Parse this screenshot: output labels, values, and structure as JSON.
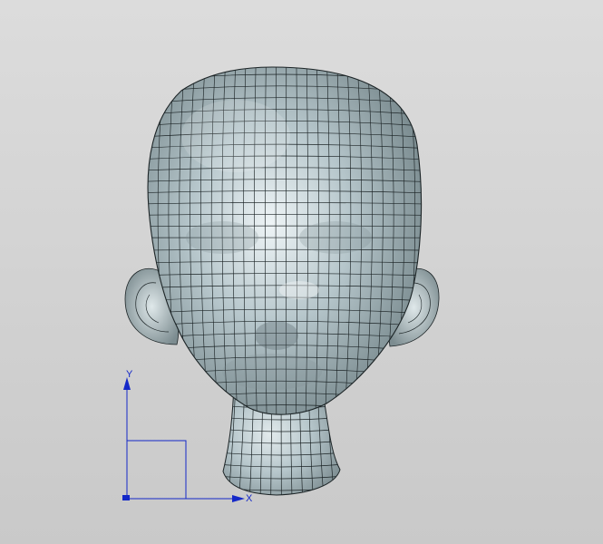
{
  "viewport": {
    "background_top": "#dcdcdc",
    "background_bottom": "#c9c9c9"
  },
  "model": {
    "surface_color": "#b6c6cb",
    "highlight_color": "#eef4f6",
    "shadow_color": "#6f8084",
    "mesh_color": "#1c2426"
  },
  "triad": {
    "color": "#1428c8",
    "y_label": "Y",
    "x_label": "X"
  }
}
